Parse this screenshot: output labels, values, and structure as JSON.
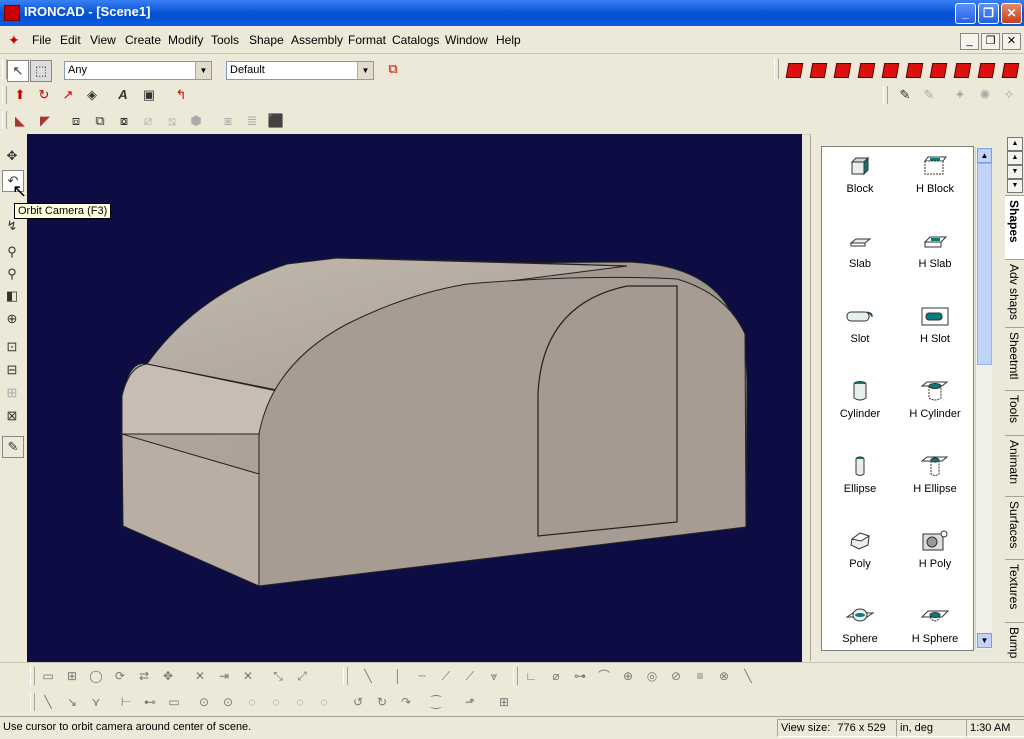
{
  "window": {
    "app_name": "IRONCAD",
    "title": "IRONCAD - [Scene1]"
  },
  "menu": [
    "File",
    "Edit",
    "View",
    "Create",
    "Modify",
    "Tools",
    "Shape",
    "Assembly",
    "Format",
    "Catalogs",
    "Window",
    "Help"
  ],
  "toolbar": {
    "selection_filter": "Any",
    "style_combo": "Default"
  },
  "tooltip": "Orbit Camera (F3)",
  "catalog": {
    "items": [
      {
        "label": "Block",
        "icon": "block-icon"
      },
      {
        "label": "H Block",
        "icon": "hollow-block-icon"
      },
      {
        "label": "Slab",
        "icon": "slab-icon"
      },
      {
        "label": "H Slab",
        "icon": "hollow-slab-icon"
      },
      {
        "label": "Slot",
        "icon": "slot-icon"
      },
      {
        "label": "H Slot",
        "icon": "hollow-slot-icon"
      },
      {
        "label": "Cylinder",
        "icon": "cylinder-icon"
      },
      {
        "label": "H Cylinder",
        "icon": "hollow-cylinder-icon"
      },
      {
        "label": "Ellipse",
        "icon": "ellipse-icon"
      },
      {
        "label": "H Ellipse",
        "icon": "hollow-ellipse-icon"
      },
      {
        "label": "Poly",
        "icon": "poly-icon"
      },
      {
        "label": "H Poly",
        "icon": "hollow-poly-icon"
      },
      {
        "label": "Sphere",
        "icon": "sphere-icon"
      },
      {
        "label": "H Sphere",
        "icon": "hollow-sphere-icon"
      }
    ],
    "tabs": [
      "Shapes",
      "Adv shaps",
      "Sheetmtl",
      "Tools",
      "Animatn",
      "Surfaces",
      "Textures",
      "Bump"
    ],
    "active_tab": "Shapes"
  },
  "status": {
    "message": "Use cursor to orbit camera around center of scene.",
    "view_size_label": "View size:",
    "view_width": "776",
    "view_x": "x",
    "view_height": "529",
    "units": "in, deg",
    "time": "1:30 AM"
  },
  "colors": {
    "viewport_bg": "#0d0c43",
    "model_face": "#a89e95",
    "titlebar": "#0a58d8"
  }
}
